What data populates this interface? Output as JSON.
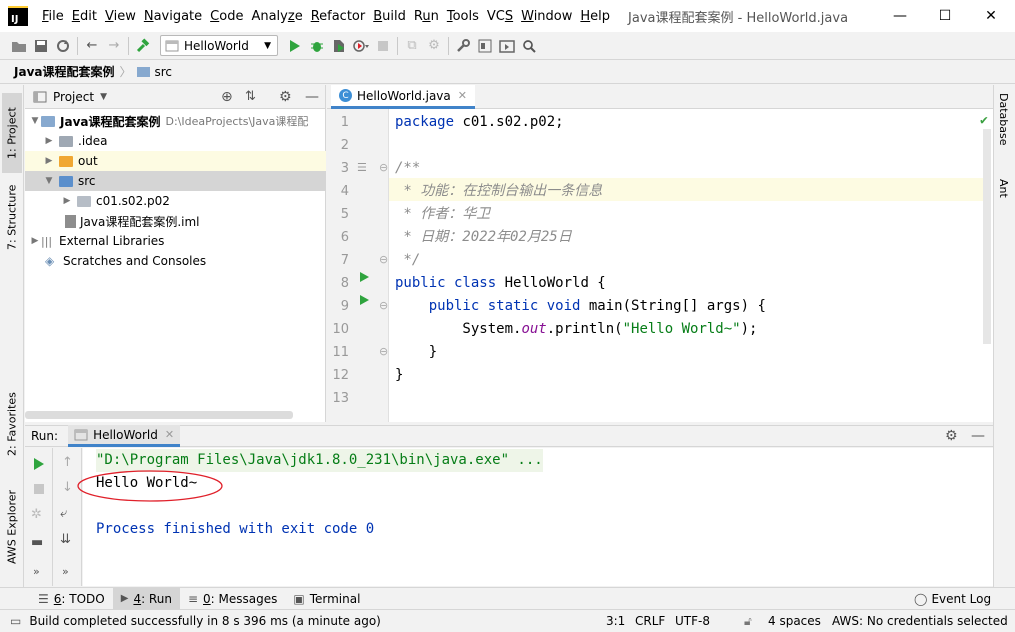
{
  "window": {
    "title": "Java课程配套案例 - HelloWorld.java",
    "controls": {
      "minimize": "—",
      "maximize": "☐",
      "close": "✕"
    }
  },
  "menu": [
    {
      "pre": "",
      "u": "F",
      "post": "ile"
    },
    {
      "pre": "",
      "u": "E",
      "post": "dit"
    },
    {
      "pre": "",
      "u": "V",
      "post": "iew"
    },
    {
      "pre": "",
      "u": "N",
      "post": "avigate"
    },
    {
      "pre": "",
      "u": "C",
      "post": "ode"
    },
    {
      "pre": "Analy",
      "u": "z",
      "post": "e"
    },
    {
      "pre": "",
      "u": "R",
      "post": "efactor"
    },
    {
      "pre": "",
      "u": "B",
      "post": "uild"
    },
    {
      "pre": "R",
      "u": "u",
      "post": "n"
    },
    {
      "pre": "",
      "u": "T",
      "post": "ools"
    },
    {
      "pre": "VC",
      "u": "S",
      "post": ""
    },
    {
      "pre": "",
      "u": "W",
      "post": "indow"
    },
    {
      "pre": "",
      "u": "H",
      "post": "elp"
    }
  ],
  "toolbar": {
    "run_config": "HelloWorld"
  },
  "breadcrumb": {
    "project": "Java课程配套案例",
    "folder": "src"
  },
  "left_strip": {
    "project": "1: Project",
    "structure": "7: Structure",
    "favorites": "2: Favorites",
    "aws": "AWS Explorer"
  },
  "right_strip": {
    "database": "Database",
    "ant": "Ant"
  },
  "project_pane": {
    "title": "Project",
    "tree": [
      {
        "label": "Java课程配套案例",
        "path": "D:\\IdeaProjects\\Java课程配",
        "bold": true
      },
      {
        "label": ".idea"
      },
      {
        "label": "out"
      },
      {
        "label": "src"
      },
      {
        "label": "c01.s02.p02"
      },
      {
        "label": "Java课程配套案例.iml"
      },
      {
        "label": "External Libraries"
      },
      {
        "label": "Scratches and Consoles"
      }
    ]
  },
  "editor": {
    "tab_label": "HelloWorld.java",
    "lines": [
      "1",
      "2",
      "3",
      "4",
      "5",
      "6",
      "7",
      "8",
      "9",
      "10",
      "11",
      "12",
      "13"
    ],
    "code": {
      "l1_kw": "package",
      "l1_rest": " c01.s02.p02;",
      "l3": "/**",
      "l4": " * 功能：在控制台输出一条信息",
      "l5": " * 作者：华卫",
      "l6": " * 日期：2022年02月25日",
      "l7": " */",
      "l8_kw": "public class",
      "l8_rest": " HelloWorld {",
      "l9_kw": "    public static void",
      "l9_rest": " main(String[] args) {",
      "l10_a": "        System.",
      "l10_out": "out",
      "l10_b": ".println(",
      "l10_str": "\"Hello World~\"",
      "l10_c": ");",
      "l11": "    }",
      "l12": "}"
    }
  },
  "run_panel": {
    "label": "Run:",
    "tab": "HelloWorld",
    "console": {
      "cmd": "\"D:\\Program Files\\Java\\jdk1.8.0_231\\bin\\java.exe\" ...",
      "output": "Hello World~",
      "finished": "Process finished with exit code 0"
    }
  },
  "tool_tabs": {
    "todo_u": "6",
    "todo": ": TODO",
    "run_u": "4",
    "run": ": Run",
    "messages_u": "0",
    "messages": ": Messages",
    "terminal": "Terminal",
    "event_log": "Event Log"
  },
  "status": {
    "message": "Build completed successfully in 8 s 396 ms (a minute ago)",
    "position": "3:1",
    "line_sep": "CRLF",
    "encoding": "UTF-8",
    "indent": "4 spaces",
    "aws": "AWS: No credentials selected"
  },
  "colors": {
    "keyword": "#0033b3",
    "comment": "#8c8c8c",
    "string": "#067d17",
    "run_green": "#2fa43e",
    "folder_blue": "#87a9cf",
    "folder_orange": "#f0a732",
    "annotation_red": "#e0202a"
  }
}
